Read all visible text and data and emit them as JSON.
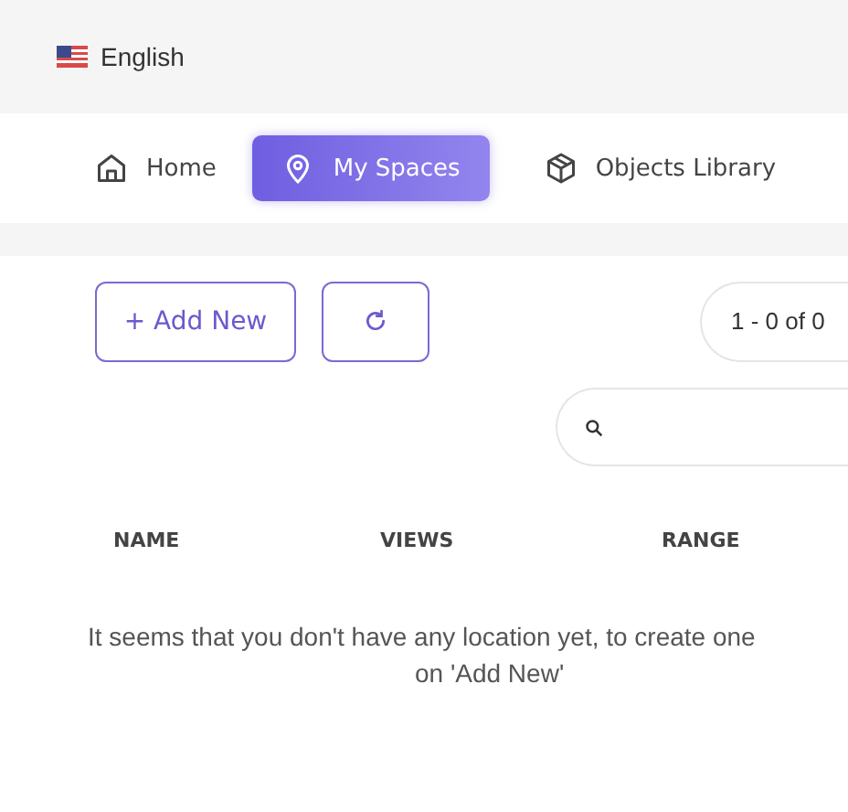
{
  "language": {
    "label": "English"
  },
  "tabs": [
    {
      "label": "Home",
      "kind": "home",
      "selected": false
    },
    {
      "label": "My Spaces",
      "kind": "place",
      "selected": true
    },
    {
      "label": "Objects Library",
      "kind": "library",
      "selected": false
    }
  ],
  "toolbar": {
    "add_button": "+ Add New",
    "pagination": "1 - 0 of 0"
  },
  "table": {
    "columns": [
      "NAME",
      "VIEWS",
      "RANGE"
    ],
    "empty_message": [
      "It seems that you don't have any location yet, to create one",
      "on 'Add New'"
    ]
  }
}
